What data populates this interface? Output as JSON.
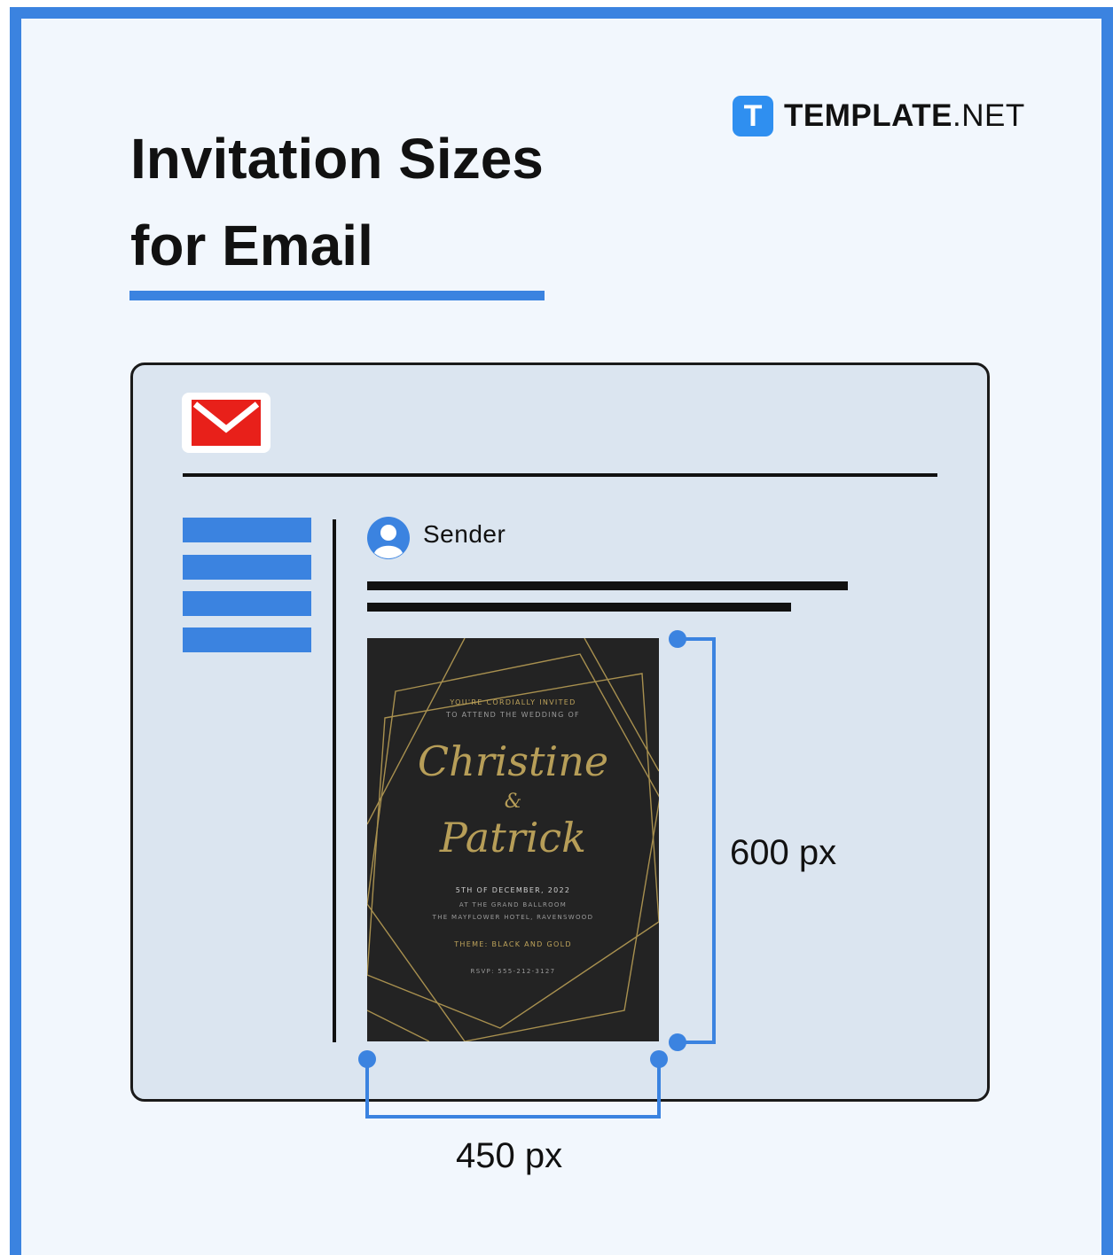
{
  "title": "Invitation Sizes for Email",
  "brand": {
    "bold": "TEMPLATE",
    "rest": ".NET",
    "icon": "T"
  },
  "email": {
    "logo_icon": "envelope-icon",
    "sender_label": "Sender",
    "avatar_icon": "user-avatar-icon"
  },
  "invitation": {
    "line1": "YOU'RE CORDIALLY INVITED",
    "line2": "TO ATTEND THE WEDDING OF",
    "name1": "Christine",
    "ampersand": "&",
    "name2": "Patrick",
    "date": "5TH OF DECEMBER, 2022",
    "detail1": "AT THE GRAND BALLROOM",
    "detail2": "THE MAYFLOWER HOTEL, RAVENSWOOD",
    "theme": "THEME: BLACK AND GOLD",
    "rsvp": "RSVP: 555-212-3127"
  },
  "dimensions": {
    "height_label": "600 px",
    "width_label": "450 px"
  },
  "colors": {
    "accent": "#3b83e0",
    "mail_red": "#e8201a",
    "gold": "#b79e58",
    "card": "#232323"
  }
}
